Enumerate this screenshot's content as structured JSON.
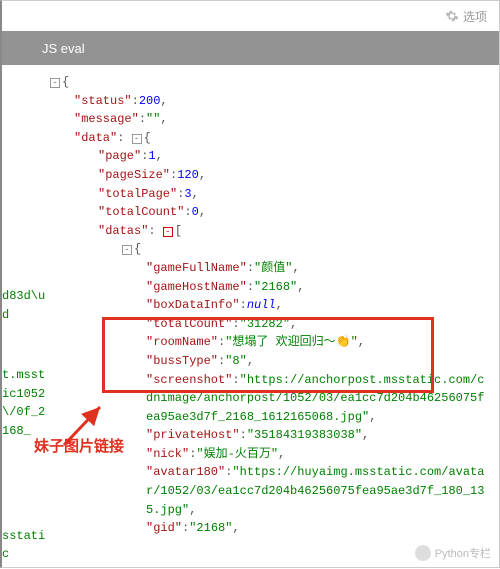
{
  "topbar": {
    "options_label": "选项"
  },
  "header": {
    "title": "JS eval"
  },
  "json": {
    "status_key": "\"status\"",
    "status_val": "200",
    "message_key": "\"message\"",
    "message_val": "\"\"",
    "data_key": "\"data\"",
    "page_key": "\"page\"",
    "page_val": "1",
    "pageSize_key": "\"pageSize\"",
    "pageSize_val": "120",
    "totalPage_key": "\"totalPage\"",
    "totalPage_val": "3",
    "totalCount_key": "\"totalCount\"",
    "totalCount_val": "0",
    "datas_key": "\"datas\"",
    "gameFullName_key": "\"gameFullName\"",
    "gameFullName_val": "\"颜值\"",
    "gameHostName_key": "\"gameHostName\"",
    "gameHostName_val": "\"2168\"",
    "boxDataInfo_key": "\"boxDataInfo\"",
    "boxDataInfo_val": "null",
    "totalCount2_key": "\"totalCount\"",
    "totalCount2_val": "\"31282\"",
    "roomName_key": "\"roomName\"",
    "roomName_val": "\"想塌了 欢迎回归～👏\"",
    "bussType_key": "\"bussType\"",
    "bussType_val": "\"8\"",
    "screenshot_key": "\"screenshot\"",
    "screenshot_val": "\"https://anchorpost.msstatic.com/cdnimage/anchorpost/1052/03/ea1cc7d204b46256075fea95ae3d7f_2168_1612165068.jpg\"",
    "privateHost_key": "\"privateHost\"",
    "privateHost_val": "\"35184319383038\"",
    "nick_key": "\"nick\"",
    "nick_val": "\"娱加-火百万\"",
    "avatar180_key": "\"avatar180\"",
    "avatar180_val": "\"https://huyaimg.msstatic.com/avatar/1052/03/ea1cc7d204b46256075fea95ae3d7f_180_135.jpg\"",
    "gid_key": "\"gid\"",
    "gid_val": "\"2168\""
  },
  "left_edges": {
    "e1": "d83d\\ud",
    "e2": "t.msstic1052\\/0f_2168_",
    "e3": "sstatic"
  },
  "annotation": {
    "text": "妹子图片链接"
  },
  "watermark": {
    "text": "Python专栏"
  },
  "colors": {
    "highlight_box": "#e03020",
    "header_bg": "#939393"
  }
}
